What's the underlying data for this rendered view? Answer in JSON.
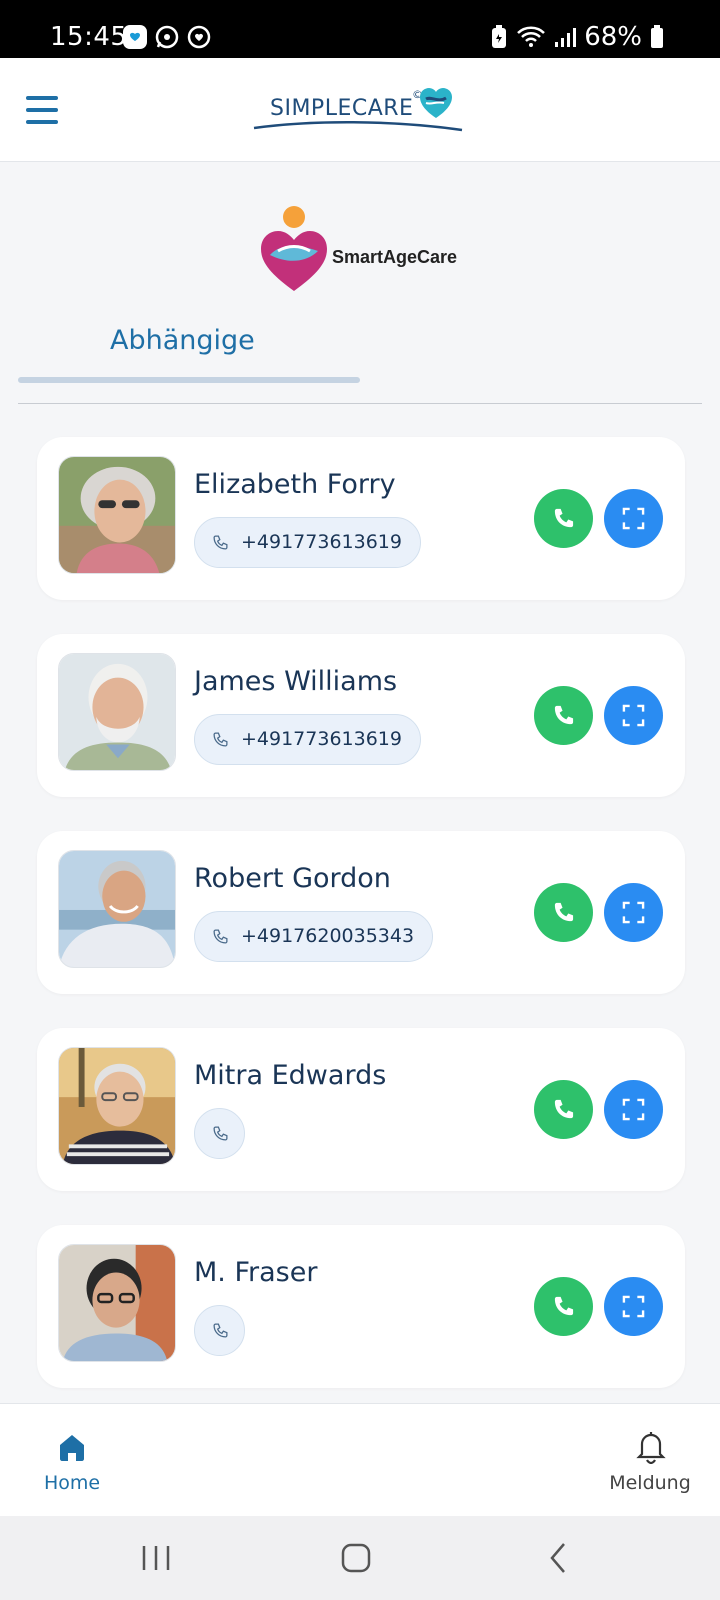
{
  "status_bar": {
    "time": "15:45",
    "battery": "68%"
  },
  "header": {
    "brand": "SIMPLECARE",
    "brand_mark": "©",
    "menu_icon": "hamburger-menu-icon"
  },
  "partner": {
    "name": "SmartAgeCare"
  },
  "tabs": [
    {
      "label": "Abhängige",
      "active": true
    }
  ],
  "dependents": [
    {
      "name": "Elizabeth Forry",
      "phone": "+491773613619"
    },
    {
      "name": "James Williams",
      "phone": "+491773613619"
    },
    {
      "name": "Robert Gordon",
      "phone": "+4917620035343"
    },
    {
      "name": "Mitra Edwards",
      "phone": ""
    },
    {
      "name": "M. Fraser",
      "phone": ""
    }
  ],
  "bottom_nav": {
    "home_label": "Home",
    "notify_label": "Meldung"
  },
  "colors": {
    "accent": "#1e6fa6",
    "call": "#2ec16b",
    "scan": "#2a8cf2"
  }
}
